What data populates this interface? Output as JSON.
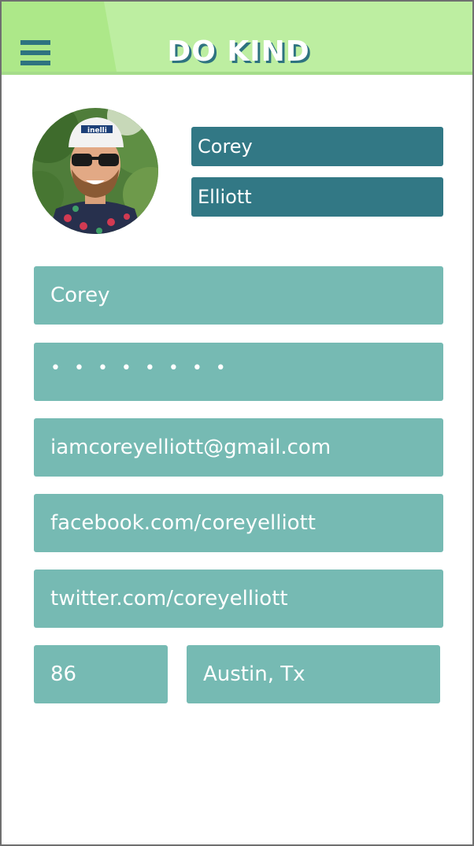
{
  "header": {
    "title": "DO KIND",
    "menu_icon": "hamburger-menu-icon",
    "colors": {
      "bar": "#bdeea1",
      "tab": "#ade889",
      "accent": "#2e7380"
    }
  },
  "profile": {
    "avatar_description": "profile-photo",
    "first_name": "Corey",
    "last_name": "Elliott",
    "name_field_color": "#327885"
  },
  "form": {
    "field_color": "#76bab3",
    "username": "Corey",
    "password": "• • • • • • • •",
    "email": "iamcoreyelliott@gmail.com",
    "facebook": "facebook.com/coreyelliott",
    "twitter": "twitter.com/coreyelliott",
    "age": "86",
    "location": "Austin, Tx"
  }
}
